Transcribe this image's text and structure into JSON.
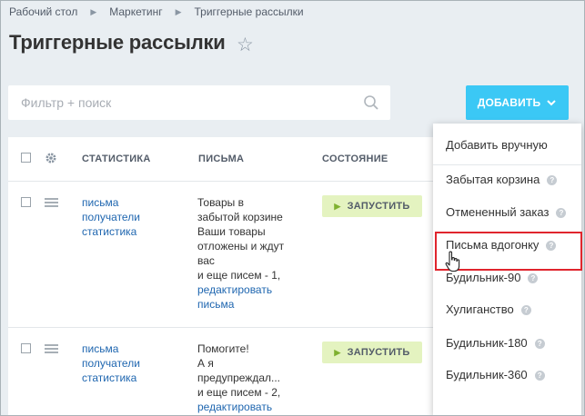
{
  "breadcrumb": {
    "items": [
      "Рабочий стол",
      "Маркетинг",
      "Триггерные рассылки"
    ],
    "separator": "▶"
  },
  "page": {
    "title": "Триггерные рассылки"
  },
  "filter": {
    "placeholder": "Фильтр + поиск"
  },
  "toolbar": {
    "add_label": "ДОБАВИТЬ"
  },
  "grid": {
    "columns": [
      "СТАТИСТИКА",
      "ПИСЬМА",
      "СОСТОЯНИЕ"
    ],
    "rows": [
      {
        "links": [
          "письма",
          "получатели",
          "статистика"
        ],
        "letters_lines": [
          "Товары в",
          "забытой корзине",
          "Ваши товары",
          "отложены и ждут",
          "вас",
          "и еще писем - 1,"
        ],
        "edit_lines": [
          "редактировать",
          "письма"
        ],
        "action": "ЗАПУСТИТЬ"
      },
      {
        "links": [
          "письма",
          "получатели",
          "статистика"
        ],
        "letters_lines": [
          "Помогите!",
          "А я",
          "предупреждал...",
          "и еще писем - 2,"
        ],
        "edit_lines": [
          "редактировать"
        ],
        "action": "ЗАПУСТИТЬ"
      }
    ]
  },
  "dropdown": {
    "items": [
      {
        "label": "Добавить вручную",
        "help": false
      },
      {
        "label": "Забытая корзина",
        "help": true
      },
      {
        "label": "Отмененный заказ",
        "help": true
      },
      {
        "label": "Письма вдогонку",
        "help": true
      },
      {
        "label": "Будильник-90",
        "help": true
      },
      {
        "label": "Хулиганство",
        "help": true
      },
      {
        "label": "Будильник-180",
        "help": true
      },
      {
        "label": "Будильник-360",
        "help": true
      }
    ],
    "help_glyph": "?"
  },
  "colors": {
    "accent": "#3bc8f5",
    "link": "#2067b0",
    "run_bg": "#e4f3c0",
    "highlight": "#e0252d"
  },
  "icons": [
    "star-icon",
    "search-icon",
    "chevron-down-icon",
    "gear-icon",
    "drag-handle-icon",
    "play-icon",
    "help-icon",
    "hand-cursor-icon"
  ]
}
